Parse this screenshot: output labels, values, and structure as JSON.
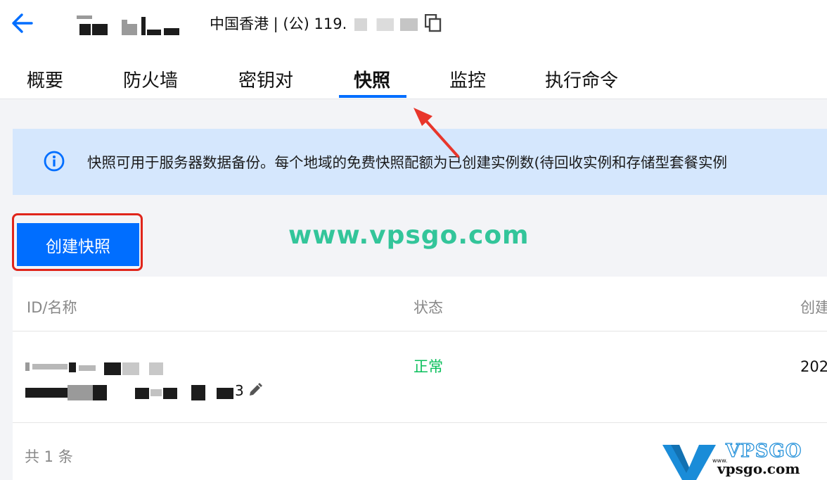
{
  "header": {
    "region_ip": "中国香港 | (公) 119.",
    "back_icon": "arrow-left-icon",
    "copy_icon": "copy-icon"
  },
  "tabs": [
    {
      "label": "概要",
      "active": false
    },
    {
      "label": "防火墙",
      "active": false
    },
    {
      "label": "密钥对",
      "active": false
    },
    {
      "label": "快照",
      "active": true
    },
    {
      "label": "监控",
      "active": false
    },
    {
      "label": "执行命令",
      "active": false
    }
  ],
  "banner": {
    "icon": "info-icon",
    "text": "快照可用于服务器数据备份。每个地域的免费快照配额为已创建实例数(待回收实例和存储型套餐实例"
  },
  "actions": {
    "create_snapshot": "创建快照"
  },
  "watermark": "www.vpsgo.com",
  "table": {
    "columns": [
      "ID/名称",
      "状态",
      "创建"
    ],
    "rows": [
      {
        "id_suffix": "3",
        "status": "正常",
        "created": "202"
      }
    ],
    "total": "共 1 条"
  },
  "logo": {
    "brand": "VPSGO",
    "url": "vpsgo.com",
    "www": "www."
  },
  "colors": {
    "primary": "#006eff",
    "status_normal": "#0abf5b",
    "banner_bg": "#d5e7fd",
    "highlight_red": "#e0251b",
    "watermark_green": "#33c59a"
  }
}
